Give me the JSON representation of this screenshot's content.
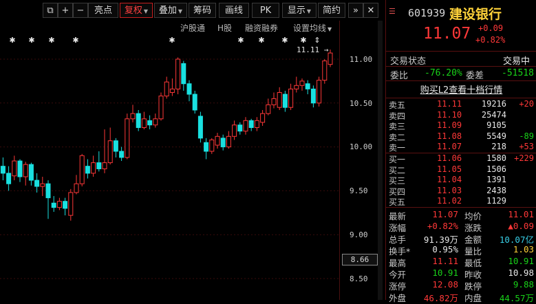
{
  "toolbar": {
    "items": [
      "亮点",
      "复权",
      "叠加",
      "筹码",
      "画线",
      "PK",
      "显示",
      "简约"
    ],
    "active_index": 1,
    "plus": "+",
    "minus": "−",
    "forward": "»"
  },
  "subbar": {
    "items": [
      "沪股通",
      "H股",
      "融资融券",
      "设置均线"
    ]
  },
  "chart": {
    "y_ticks": [
      "11.00",
      "10.50",
      "10.00",
      "9.50",
      "9.00",
      "8.50"
    ],
    "current_price_box": "8.66",
    "high_annotation": "11.11"
  },
  "chart_data": {
    "type": "candlestick",
    "ylim": [
      8.3,
      11.25
    ],
    "y_ticks": [
      11.0,
      10.5,
      10.0,
      9.5,
      9.0,
      8.5
    ],
    "candles": [
      {
        "o": 9.78,
        "c": 9.7,
        "h": 9.88,
        "l": 9.62
      },
      {
        "o": 9.7,
        "c": 9.58,
        "h": 9.78,
        "l": 9.5
      },
      {
        "o": 9.67,
        "c": 9.84,
        "h": 9.9,
        "l": 9.62
      },
      {
        "o": 9.84,
        "c": 9.66,
        "h": 9.86,
        "l": 9.6
      },
      {
        "o": 9.66,
        "c": 9.8,
        "h": 9.83,
        "l": 9.56
      },
      {
        "o": 9.8,
        "c": 9.62,
        "h": 9.82,
        "l": 9.56
      },
      {
        "o": 9.62,
        "c": 9.55,
        "h": 9.7,
        "l": 9.48
      },
      {
        "o": 9.55,
        "c": 9.58,
        "h": 9.66,
        "l": 9.44
      },
      {
        "o": 9.58,
        "c": 9.42,
        "h": 9.62,
        "l": 9.18
      },
      {
        "o": 9.36,
        "c": 9.31,
        "h": 9.44,
        "l": 9.26
      },
      {
        "o": 9.31,
        "c": 9.38,
        "h": 9.42,
        "l": 9.28
      },
      {
        "o": 9.38,
        "c": 9.3,
        "h": 9.42,
        "l": 9.22
      },
      {
        "o": 9.22,
        "c": 9.48,
        "h": 9.52,
        "l": 9.16
      },
      {
        "o": 9.48,
        "c": 9.58,
        "h": 9.68,
        "l": 9.46
      },
      {
        "o": 9.58,
        "c": 9.9,
        "h": 9.92,
        "l": 9.55
      },
      {
        "o": 9.78,
        "c": 9.7,
        "h": 9.86,
        "l": 9.64
      },
      {
        "o": 9.7,
        "c": 9.82,
        "h": 9.9,
        "l": 9.66
      },
      {
        "o": 9.82,
        "c": 9.75,
        "h": 9.95,
        "l": 9.72
      },
      {
        "o": 9.75,
        "c": 9.82,
        "h": 10.2,
        "l": 9.7
      },
      {
        "o": 9.82,
        "c": 10.07,
        "h": 10.22,
        "l": 9.8
      },
      {
        "o": 10.07,
        "c": 9.95,
        "h": 10.1,
        "l": 9.88
      },
      {
        "o": 9.95,
        "c": 9.88,
        "h": 10.0,
        "l": 9.84
      },
      {
        "o": 9.88,
        "c": 10.32,
        "h": 10.38,
        "l": 9.86
      },
      {
        "o": 10.32,
        "c": 10.38,
        "h": 10.48,
        "l": 10.28
      },
      {
        "o": 10.38,
        "c": 10.22,
        "h": 10.42,
        "l": 10.18
      },
      {
        "o": 10.22,
        "c": 10.32,
        "h": 10.4,
        "l": 10.2
      },
      {
        "o": 10.3,
        "c": 10.25,
        "h": 10.36,
        "l": 10.2
      },
      {
        "o": 10.25,
        "c": 10.32,
        "h": 10.38,
        "l": 10.22
      },
      {
        "o": 10.32,
        "c": 10.58,
        "h": 10.62,
        "l": 10.3
      },
      {
        "o": 10.58,
        "c": 10.74,
        "h": 10.8,
        "l": 10.55
      },
      {
        "o": 10.62,
        "c": 10.66,
        "h": 10.78,
        "l": 10.58
      },
      {
        "o": 10.66,
        "c": 11.0,
        "h": 11.02,
        "l": 10.6
      },
      {
        "o": 10.95,
        "c": 10.72,
        "h": 10.98,
        "l": 10.64
      },
      {
        "o": 10.72,
        "c": 10.6,
        "h": 10.76,
        "l": 10.52
      },
      {
        "o": 10.6,
        "c": 10.42,
        "h": 10.64,
        "l": 10.38
      },
      {
        "o": 10.35,
        "c": 10.1,
        "h": 10.4,
        "l": 10.05
      },
      {
        "o": 10.05,
        "c": 9.95,
        "h": 10.1,
        "l": 9.86
      },
      {
        "o": 9.95,
        "c": 10.08,
        "h": 10.1,
        "l": 9.92
      },
      {
        "o": 10.02,
        "c": 10.12,
        "h": 10.16,
        "l": 9.98
      },
      {
        "o": 10.1,
        "c": 10.0,
        "h": 10.14,
        "l": 9.96
      },
      {
        "o": 10.0,
        "c": 10.12,
        "h": 10.18,
        "l": 9.98
      },
      {
        "o": 10.12,
        "c": 10.25,
        "h": 10.3,
        "l": 10.08
      },
      {
        "o": 10.25,
        "c": 10.18,
        "h": 10.28,
        "l": 10.14
      },
      {
        "o": 10.18,
        "c": 10.3,
        "h": 10.34,
        "l": 10.14
      },
      {
        "o": 10.3,
        "c": 10.22,
        "h": 10.32,
        "l": 10.18
      },
      {
        "o": 10.22,
        "c": 10.3,
        "h": 10.34,
        "l": 10.18
      },
      {
        "o": 10.28,
        "c": 10.38,
        "h": 10.42,
        "l": 10.24
      },
      {
        "o": 10.38,
        "c": 10.48,
        "h": 10.55,
        "l": 10.36
      },
      {
        "o": 10.48,
        "c": 10.55,
        "h": 10.62,
        "l": 10.44
      },
      {
        "o": 10.45,
        "c": 10.62,
        "h": 10.68,
        "l": 10.42
      },
      {
        "o": 10.6,
        "c": 10.45,
        "h": 10.64,
        "l": 10.4
      },
      {
        "o": 10.45,
        "c": 10.66,
        "h": 10.72,
        "l": 10.42
      },
      {
        "o": 10.66,
        "c": 10.7,
        "h": 10.8,
        "l": 10.62
      },
      {
        "o": 10.7,
        "c": 10.75,
        "h": 10.78,
        "l": 10.64
      },
      {
        "o": 10.72,
        "c": 10.66,
        "h": 10.76,
        "l": 10.6
      },
      {
        "o": 10.66,
        "c": 10.5,
        "h": 10.7,
        "l": 10.45
      },
      {
        "o": 10.5,
        "c": 10.76,
        "h": 10.8,
        "l": 10.46
      },
      {
        "o": 10.76,
        "c": 10.98,
        "h": 11.0,
        "l": 10.72
      },
      {
        "o": 10.94,
        "c": 11.07,
        "h": 11.11,
        "l": 10.91
      }
    ]
  },
  "quote": {
    "code": "601939",
    "name": "建设银行",
    "price": "11.07",
    "change": "+0.09",
    "change_pct": "+0.82%",
    "status_label": "交易状态",
    "status_value": "交易中",
    "weibi_label": "委比",
    "weibi_value": "-76.20%",
    "weicha_label": "委差",
    "weicha_value": "-51518",
    "l2_link": "购买L2查看十档行情",
    "asks": [
      {
        "label": "卖五",
        "price": "11.11",
        "vol": "19216",
        "chg": "+20"
      },
      {
        "label": "卖四",
        "price": "11.10",
        "vol": "25474",
        "chg": ""
      },
      {
        "label": "卖三",
        "price": "11.09",
        "vol": "9105",
        "chg": ""
      },
      {
        "label": "卖二",
        "price": "11.08",
        "vol": "5549",
        "chg": "-89"
      },
      {
        "label": "卖一",
        "price": "11.07",
        "vol": "218",
        "chg": "+53"
      }
    ],
    "bids": [
      {
        "label": "买一",
        "price": "11.06",
        "vol": "1580",
        "chg": "+229"
      },
      {
        "label": "买二",
        "price": "11.05",
        "vol": "1506",
        "chg": ""
      },
      {
        "label": "买三",
        "price": "11.04",
        "vol": "1391",
        "chg": ""
      },
      {
        "label": "买四",
        "price": "11.03",
        "vol": "2438",
        "chg": ""
      },
      {
        "label": "买五",
        "price": "11.02",
        "vol": "1129",
        "chg": ""
      }
    ],
    "stats": [
      {
        "l1": "最新",
        "v1": "11.07",
        "c1": "red",
        "l2": "均价",
        "v2": "11.01",
        "c2": "red"
      },
      {
        "l1": "涨幅",
        "v1": "+0.82%",
        "c1": "red",
        "l2": "涨跌",
        "v2": "▲0.09",
        "c2": "red"
      },
      {
        "l1": "总手",
        "v1": "91.39万",
        "c1": "white",
        "l2": "金额",
        "v2": "10.07亿",
        "c2": "cyan"
      },
      {
        "l1": "换手*",
        "v1": "0.95%",
        "c1": "white",
        "l2": "量比",
        "v2": "1.03",
        "c2": "yellow"
      },
      {
        "l1": "最高",
        "v1": "11.11",
        "c1": "red",
        "l2": "最低",
        "v2": "10.91",
        "c2": "green"
      },
      {
        "l1": "今开",
        "v1": "10.91",
        "c1": "green",
        "l2": "昨收",
        "v2": "10.98",
        "c2": "white"
      },
      {
        "l1": "涨停",
        "v1": "12.08",
        "c1": "red",
        "l2": "跌停",
        "v2": "9.88",
        "c2": "green"
      },
      {
        "l1": "外盘",
        "v1": "46.82万",
        "c1": "red",
        "l2": "内盘",
        "v2": "44.57万",
        "c2": "green"
      }
    ]
  },
  "colors": {
    "up": "#ff3838",
    "down": "#19e0e0",
    "grid": "#3a0c0c"
  }
}
